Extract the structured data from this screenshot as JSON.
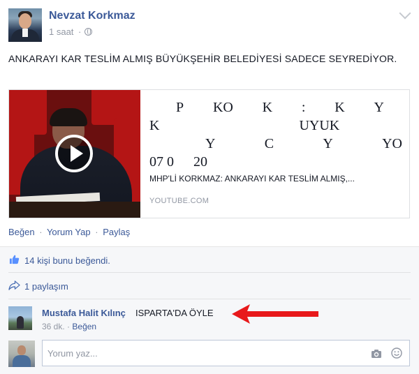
{
  "post": {
    "author": "Nevzat Korkmaz",
    "time": "1 saat",
    "text": "ANKARAYI KAR TESLİM ALMIŞ BÜYÜKŞEHİR BELEDİYESİ SADECE SEYREDİYOR."
  },
  "link_preview": {
    "title_lines": [
      [
        "P",
        "KO",
        "K",
        ":",
        "K",
        "Y"
      ],
      [
        "K",
        "UYUK"
      ],
      [
        "Y",
        "C",
        "Y",
        "YO"
      ],
      [
        "07 0",
        "20"
      ]
    ],
    "description": "MHP'Lİ KORKMAZ: ANKARAYI KAR TESLİM ALMIŞ,...",
    "source": "YOUTUBE.COM"
  },
  "actions": {
    "like": "Beğen",
    "comment": "Yorum Yap",
    "share": "Paylaş",
    "separator": "·"
  },
  "feedback": {
    "likes": "14 kişi bunu beğendi.",
    "shares": "1 paylaşım"
  },
  "comment": {
    "author": "Mustafa Halit Kılınç",
    "text": "ISPARTA'DA ÖYLE",
    "time": "36 dk.",
    "separator": "·",
    "like": "Beğen"
  },
  "reply": {
    "placeholder": "Yorum yaz..."
  },
  "colors": {
    "link": "#3b5998",
    "meta": "#9197a3",
    "arrow": "#e8191b",
    "feedback_bg": "#f6f7f9"
  },
  "icons": [
    "globe-icon",
    "chevron-down-icon",
    "play-icon",
    "thumbs-up-icon",
    "share-arrow-icon",
    "red-arrow-icon",
    "camera-icon",
    "smiley-icon"
  ]
}
